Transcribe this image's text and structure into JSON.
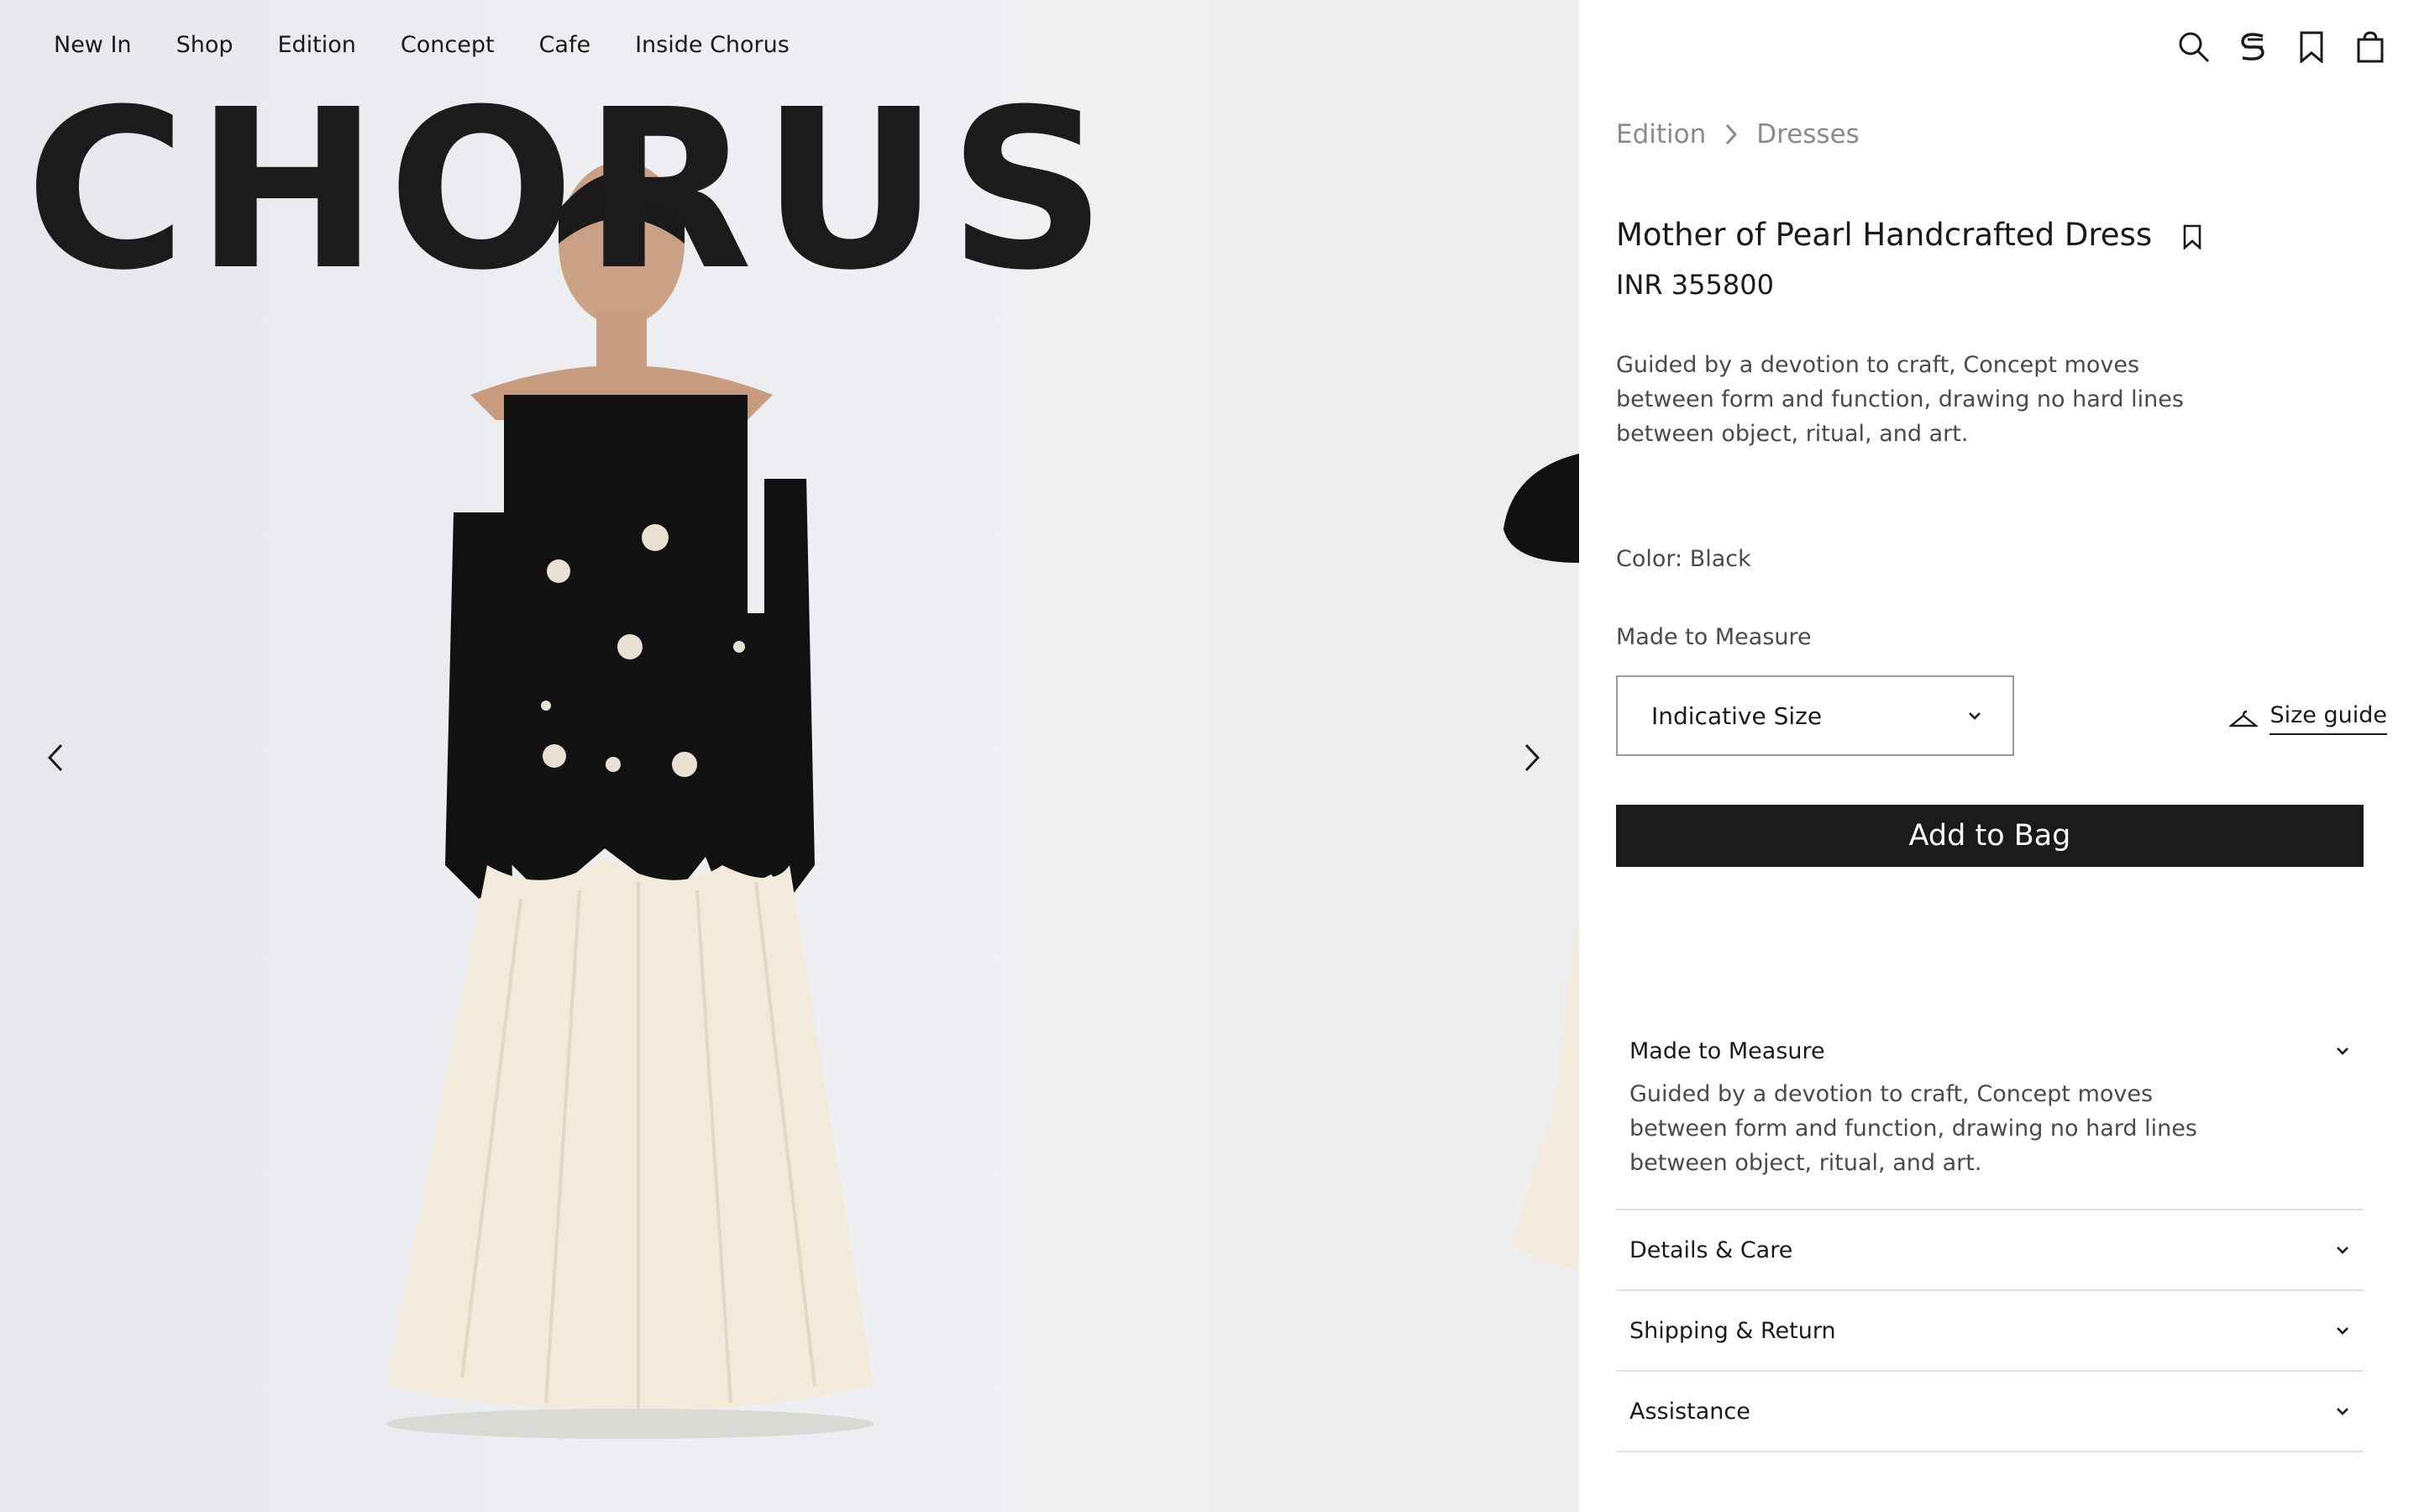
{
  "nav": {
    "items": [
      "New In",
      "Shop",
      "Edition",
      "Concept",
      "Cafe",
      "Inside Chorus"
    ]
  },
  "brand": {
    "logo_text": "CHORUS"
  },
  "gallery": {
    "prev_icon": "chevron-left-icon",
    "next_icon": "chevron-right-icon"
  },
  "header_icons": [
    "search-icon",
    "chorus-emblem-icon",
    "bookmark-icon",
    "shopping-bag-icon"
  ],
  "breadcrumb": {
    "level1": "Edition",
    "level2": "Dresses"
  },
  "product": {
    "title": "Mother of Pearl Handcrafted Dress",
    "price": "INR 355800",
    "description": "Guided by a devotion to craft, Concept moves between form and function, drawing no hard lines between object, ritual, and art.",
    "color_label": "Color: Black",
    "made_to_measure_label": "Made to Measure",
    "size_select_value": "Indicative Size",
    "size_guide_label": "Size guide",
    "add_to_bag_label": "Add to Bag"
  },
  "accordion": [
    {
      "title": "Made to Measure",
      "body": "Guided by a devotion to craft, Concept moves between form and function, drawing no hard lines between object, ritual, and art.",
      "open": true
    },
    {
      "title": "Details & Care",
      "open": false
    },
    {
      "title": "Shipping & Return",
      "open": false
    },
    {
      "title": "Assistance",
      "open": false
    }
  ],
  "colors": {
    "text": "#1a1a1a",
    "muted": "#8a8a8a",
    "button_bg": "#1b1b1b",
    "gallery_bg": "#eceef1"
  }
}
